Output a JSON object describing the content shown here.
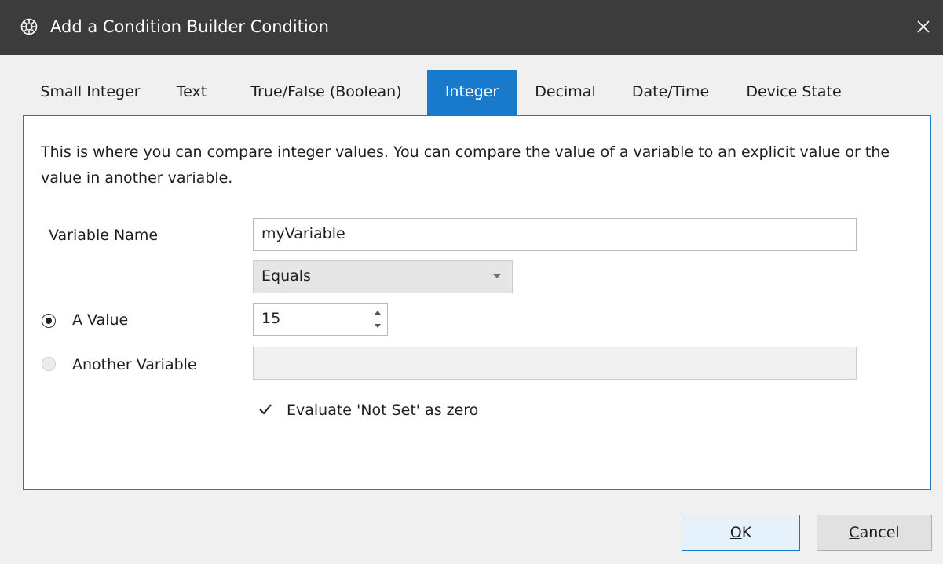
{
  "window": {
    "title": "Add a Condition Builder Condition",
    "app_icon": "gear-badge-icon",
    "close_icon": "close-icon"
  },
  "tabs": [
    {
      "label": "Small Integer",
      "active": false
    },
    {
      "label": "Text",
      "active": false
    },
    {
      "label": "True/False (Boolean)",
      "active": false
    },
    {
      "label": "Integer",
      "active": true
    },
    {
      "label": "Decimal",
      "active": false
    },
    {
      "label": "Date/Time",
      "active": false
    },
    {
      "label": "Device State",
      "active": false
    }
  ],
  "panel": {
    "description": "This is where you can compare integer values.  You can compare the value of a variable to an explicit value or the value in another variable.",
    "variable_name_label": "Variable Name",
    "variable_name_value": "myVariable",
    "comparison": {
      "selected": "Equals"
    },
    "a_value_label": "A Value",
    "a_value_checked": true,
    "a_value": "15",
    "another_variable_label": "Another Variable",
    "another_variable_checked": false,
    "another_variable_value": "",
    "evaluate_not_set_label": "Evaluate 'Not Set' as zero",
    "evaluate_not_set_checked": true
  },
  "buttons": {
    "ok_label": "OK",
    "cancel_label": "Cancel"
  },
  "colors": {
    "accent": "#1979ca",
    "titlebar": "#3c3c3c"
  }
}
